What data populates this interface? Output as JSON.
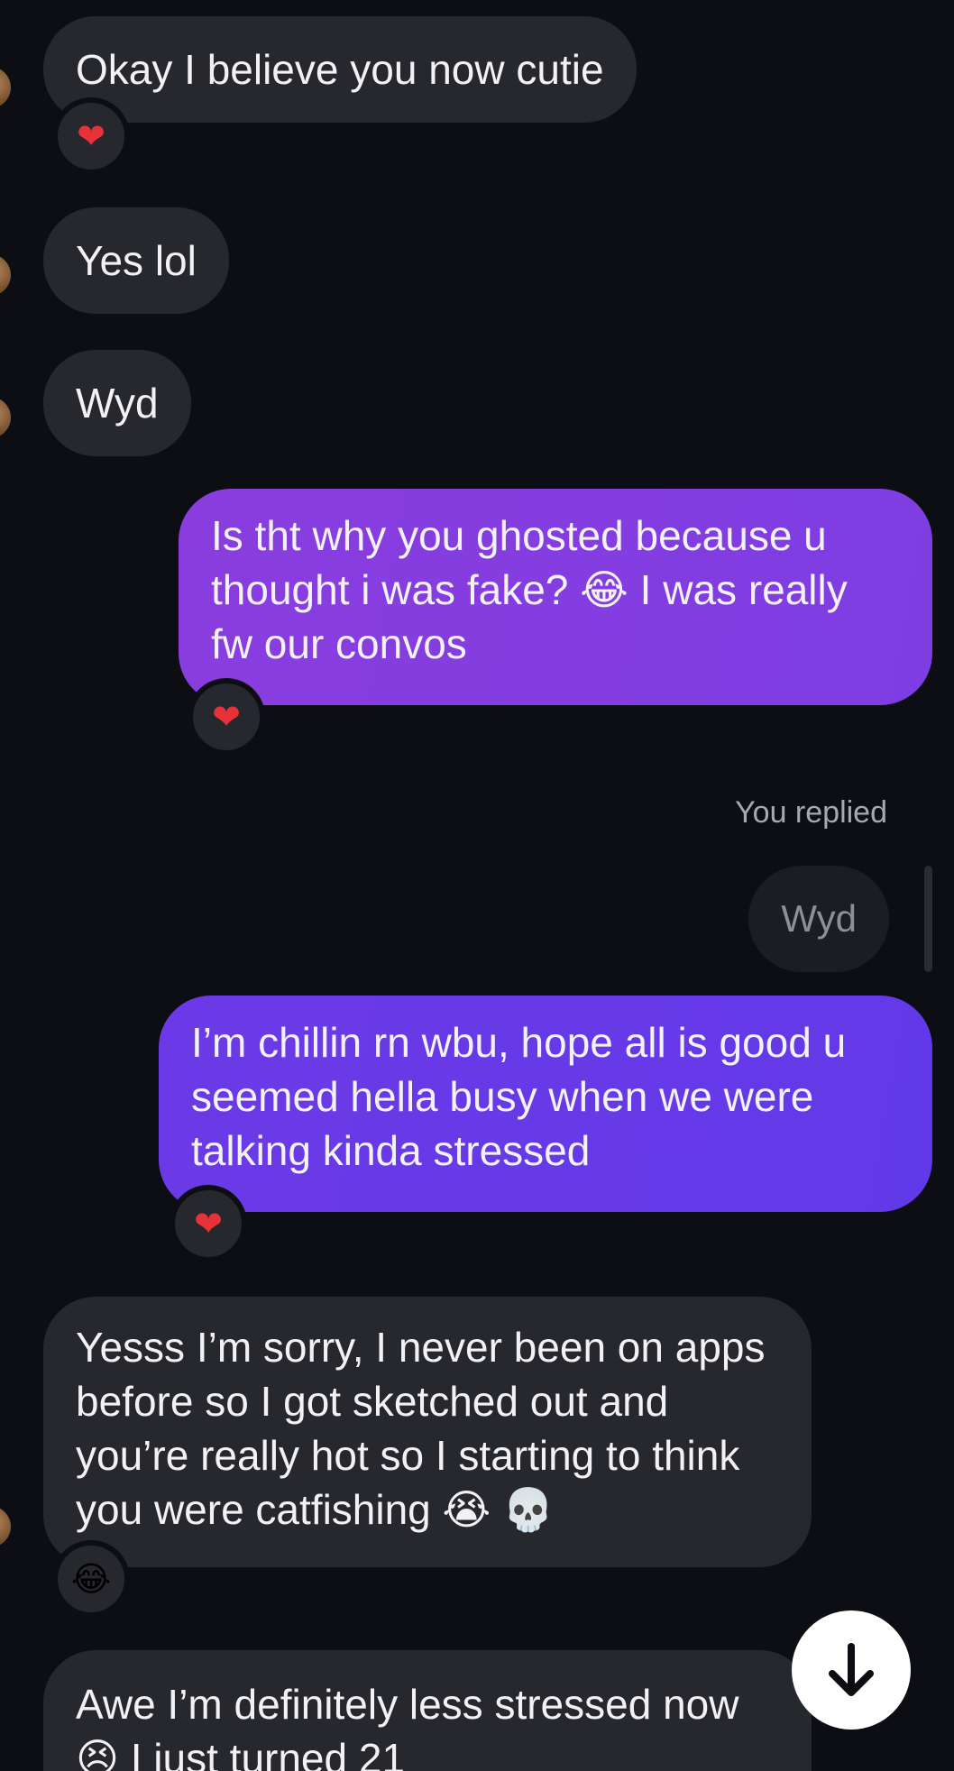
{
  "messages": [
    {
      "text": "Okay I believe you now cutie",
      "reaction": "❤"
    },
    {
      "text": "Yes lol"
    },
    {
      "text": "Wyd"
    },
    {
      "text": "Is tht why you ghosted because u thought i was fake? 😂 I was really fw our convos",
      "reaction": "❤"
    },
    {
      "reply_label": "You replied",
      "quoted": "Wyd"
    },
    {
      "text": "I’m chillin rn wbu, hope all is good u seemed hella busy when we were talking kinda stressed",
      "reaction": "❤"
    },
    {
      "text": "Yesss I’m sorry, I never been on apps before so I got sketched out and you’re really hot so I starting to think you were catfishing 😭 💀",
      "reaction": "😂"
    },
    {
      "text": "Awe I’m definitely less stressed now 😣 I just turned 21"
    }
  ],
  "colors": {
    "background": "#0c0e13",
    "incoming_bubble": "#26282d",
    "outgoing_bubble_1": "#8a3ddf",
    "outgoing_bubble_2": "#6b3ae6",
    "reaction_heart": "#e8323a"
  },
  "icons": {
    "scroll_button": "arrow-down-icon"
  }
}
